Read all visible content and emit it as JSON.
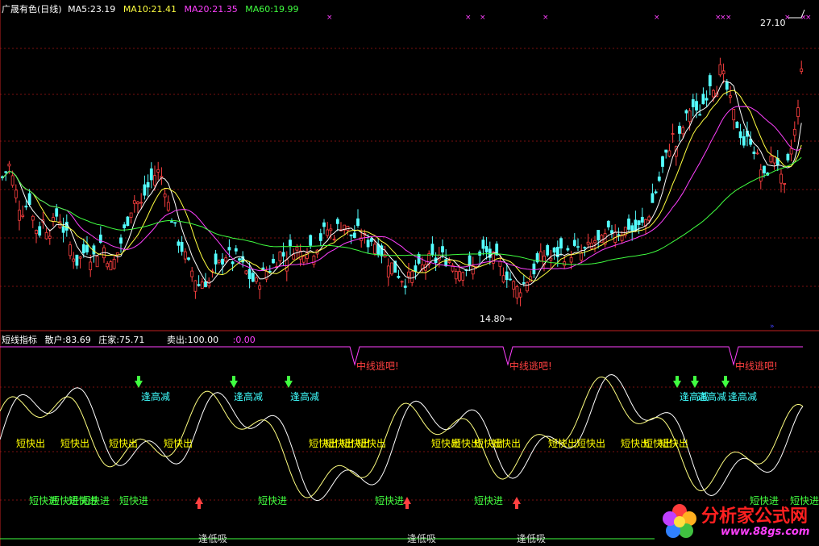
{
  "colors": {
    "bg": "#000000",
    "grid": "#7a1010",
    "candle_up": "#ff4040",
    "candle_down": "#54ffff",
    "ma5": "#ffffff",
    "ma10": "#ffff40",
    "ma20": "#ff40ff",
    "ma60": "#40ff40",
    "signal_yellow": "#ffff00",
    "signal_green": "#40ff40",
    "signal_cyan": "#40ffff",
    "signal_red": "#ff4040",
    "magenta": "#ff40ff",
    "watermark_red": "#ff2020",
    "watermark_url": "#ff40ff"
  },
  "main_panel": {
    "title": "广晟有色(日线)",
    "ma5": "MA5:23.19",
    "ma10": "MA10:21.41",
    "ma20": "MA20:21.35",
    "ma60": "MA60:19.99",
    "high_label": "27.10",
    "low_label": "14.80→",
    "price_axis": {
      "min": 13.5,
      "max": 28.5
    }
  },
  "indicator_panel": {
    "name": "短线指标",
    "retail": "散户:83.69",
    "dealer": "庄家:75.71",
    "sell": "卖出:100.00",
    "zero": ":0.00",
    "signals": {
      "escape": "中线逃吧!",
      "top_reduce": "逢高减",
      "quick_out": "短快出",
      "quick_in": "短快进",
      "bottom_buy": "逢低吸"
    },
    "escape_positions": [
      440,
      630,
      910
    ],
    "top_reduce_positions": [
      175,
      290,
      360,
      843,
      865,
      903
    ],
    "quick_out_positions": [
      20,
      75,
      135,
      203,
      383,
      403,
      423,
      443,
      535,
      560,
      588,
      610,
      680,
      715,
      770,
      798,
      818
    ],
    "quick_in_positions": [
      36,
      62,
      85,
      100,
      148,
      320,
      465,
      588,
      930,
      980
    ],
    "bottom_buy_positions": [
      246,
      505,
      641
    ],
    "down_arrow_positions": [
      172,
      290,
      358,
      840,
      862,
      900
    ],
    "up_arrow_positions": [
      247,
      505,
      641
    ]
  },
  "watermark": {
    "name": "分析家公式网",
    "url": "www.88gs.com"
  },
  "chart_data": {
    "type": "candlestick",
    "title": "广晟有色(日线)",
    "series_names": [
      "MA5",
      "MA10",
      "MA20",
      "MA60"
    ],
    "high": 27.1,
    "low": 14.8,
    "last_ma": {
      "MA5": 23.19,
      "MA10": 21.41,
      "MA20": 21.35,
      "MA60": 19.99
    },
    "indicator": {
      "散户": 83.69,
      "庄家": 75.71,
      "卖出": 100.0,
      "baseline": 0.0
    },
    "close_path": [
      [
        0,
        20.3
      ],
      [
        6,
        20.8
      ],
      [
        12,
        21.2
      ],
      [
        18,
        20.1
      ],
      [
        24,
        19.2
      ],
      [
        30,
        18.9
      ],
      [
        36,
        19.6
      ],
      [
        42,
        18.4
      ],
      [
        48,
        17.8
      ],
      [
        54,
        18.5
      ],
      [
        60,
        17.9
      ],
      [
        66,
        18.3
      ],
      [
        72,
        18.9
      ],
      [
        78,
        18.1
      ],
      [
        84,
        17.6
      ],
      [
        90,
        16.9
      ],
      [
        96,
        16.4
      ],
      [
        102,
        16.8
      ],
      [
        108,
        17.2
      ],
      [
        114,
        16.6
      ],
      [
        120,
        16.9
      ],
      [
        126,
        17.5
      ],
      [
        132,
        16.8
      ],
      [
        138,
        16.2
      ],
      [
        144,
        16.7
      ],
      [
        150,
        17.4
      ],
      [
        156,
        18.2
      ],
      [
        162,
        19.0
      ],
      [
        168,
        19.6
      ],
      [
        174,
        19.1
      ],
      [
        180,
        19.8
      ],
      [
        186,
        20.3
      ],
      [
        192,
        20.7
      ],
      [
        198,
        20.9
      ],
      [
        204,
        20.2
      ],
      [
        210,
        19.0
      ],
      [
        216,
        18.2
      ],
      [
        222,
        17.4
      ],
      [
        228,
        16.9
      ],
      [
        234,
        16.3
      ],
      [
        240,
        15.9
      ],
      [
        246,
        15.3
      ],
      [
        252,
        15.6
      ],
      [
        258,
        15.4
      ],
      [
        264,
        15.9
      ],
      [
        270,
        16.2
      ],
      [
        276,
        16.6
      ],
      [
        282,
        16.9
      ],
      [
        288,
        16.5
      ],
      [
        294,
        16.7
      ],
      [
        300,
        16.3
      ],
      [
        306,
        15.9
      ],
      [
        312,
        15.6
      ],
      [
        318,
        15.4
      ],
      [
        324,
        15.7
      ],
      [
        330,
        16.0
      ],
      [
        336,
        16.2
      ],
      [
        342,
        16.5
      ],
      [
        348,
        16.9
      ],
      [
        354,
        16.7
      ],
      [
        360,
        17.0
      ],
      [
        366,
        17.2
      ],
      [
        372,
        16.9
      ],
      [
        378,
        17.1
      ],
      [
        384,
        17.3
      ],
      [
        390,
        17.0
      ],
      [
        396,
        17.5
      ],
      [
        402,
        17.9
      ],
      [
        408,
        18.1
      ],
      [
        414,
        17.8
      ],
      [
        420,
        18.2
      ],
      [
        426,
        18.4
      ],
      [
        432,
        18.0
      ],
      [
        438,
        17.6
      ],
      [
        444,
        17.9
      ],
      [
        450,
        17.7
      ],
      [
        456,
        17.4
      ],
      [
        462,
        17.6
      ],
      [
        468,
        17.2
      ],
      [
        474,
        16.9
      ],
      [
        480,
        16.6
      ],
      [
        486,
        16.3
      ],
      [
        492,
        16.0
      ],
      [
        498,
        15.7
      ],
      [
        504,
        15.5
      ],
      [
        510,
        15.8
      ],
      [
        516,
        16.0
      ],
      [
        522,
        16.1
      ],
      [
        528,
        16.4
      ],
      [
        534,
        16.6
      ],
      [
        540,
        16.5
      ],
      [
        546,
        16.8
      ],
      [
        552,
        16.6
      ],
      [
        558,
        16.5
      ],
      [
        564,
        16.3
      ],
      [
        570,
        16.1
      ],
      [
        576,
        16.3
      ],
      [
        582,
        16.0
      ],
      [
        588,
        16.2
      ],
      [
        594,
        16.6
      ],
      [
        600,
        17.0
      ],
      [
        606,
        16.8
      ],
      [
        612,
        16.6
      ],
      [
        618,
        16.4
      ],
      [
        624,
        16.1
      ],
      [
        630,
        15.8
      ],
      [
        636,
        15.4
      ],
      [
        642,
        15.1
      ],
      [
        648,
        15.3
      ],
      [
        654,
        15.6
      ],
      [
        660,
        15.9
      ],
      [
        666,
        16.3
      ],
      [
        672,
        16.7
      ],
      [
        678,
        16.9
      ],
      [
        684,
        16.6
      ],
      [
        690,
        16.8
      ],
      [
        696,
        17.0
      ],
      [
        702,
        16.7
      ],
      [
        708,
        16.9
      ],
      [
        714,
        17.1
      ],
      [
        720,
        16.8
      ],
      [
        726,
        17.0
      ],
      [
        732,
        17.2
      ],
      [
        738,
        17.5
      ],
      [
        744,
        17.3
      ],
      [
        750,
        17.6
      ],
      [
        756,
        17.9
      ],
      [
        762,
        18.1
      ],
      [
        768,
        17.9
      ],
      [
        774,
        18.0
      ],
      [
        780,
        18.2
      ],
      [
        786,
        17.9
      ],
      [
        792,
        18.1
      ],
      [
        798,
        18.3
      ],
      [
        804,
        18.7
      ],
      [
        810,
        19.4
      ],
      [
        816,
        20.2
      ],
      [
        822,
        21.0
      ],
      [
        828,
        21.8
      ],
      [
        834,
        22.6
      ],
      [
        840,
        22.0
      ],
      [
        846,
        22.9
      ],
      [
        852,
        23.5
      ],
      [
        858,
        24.2
      ],
      [
        864,
        23.6
      ],
      [
        870,
        23.9
      ],
      [
        876,
        24.6
      ],
      [
        882,
        25.4
      ],
      [
        888,
        24.8
      ],
      [
        894,
        25.9
      ],
      [
        900,
        25.1
      ],
      [
        906,
        24.2
      ],
      [
        912,
        23.4
      ],
      [
        918,
        22.8
      ],
      [
        924,
        22.1
      ],
      [
        930,
        22.6
      ],
      [
        936,
        21.9
      ],
      [
        942,
        21.2
      ],
      [
        948,
        20.5
      ],
      [
        954,
        21.1
      ],
      [
        960,
        21.8
      ],
      [
        966,
        21.2
      ],
      [
        972,
        19.6
      ],
      [
        978,
        21.3
      ],
      [
        984,
        22.4
      ],
      [
        990,
        23.8
      ],
      [
        996,
        27.1
      ]
    ]
  }
}
